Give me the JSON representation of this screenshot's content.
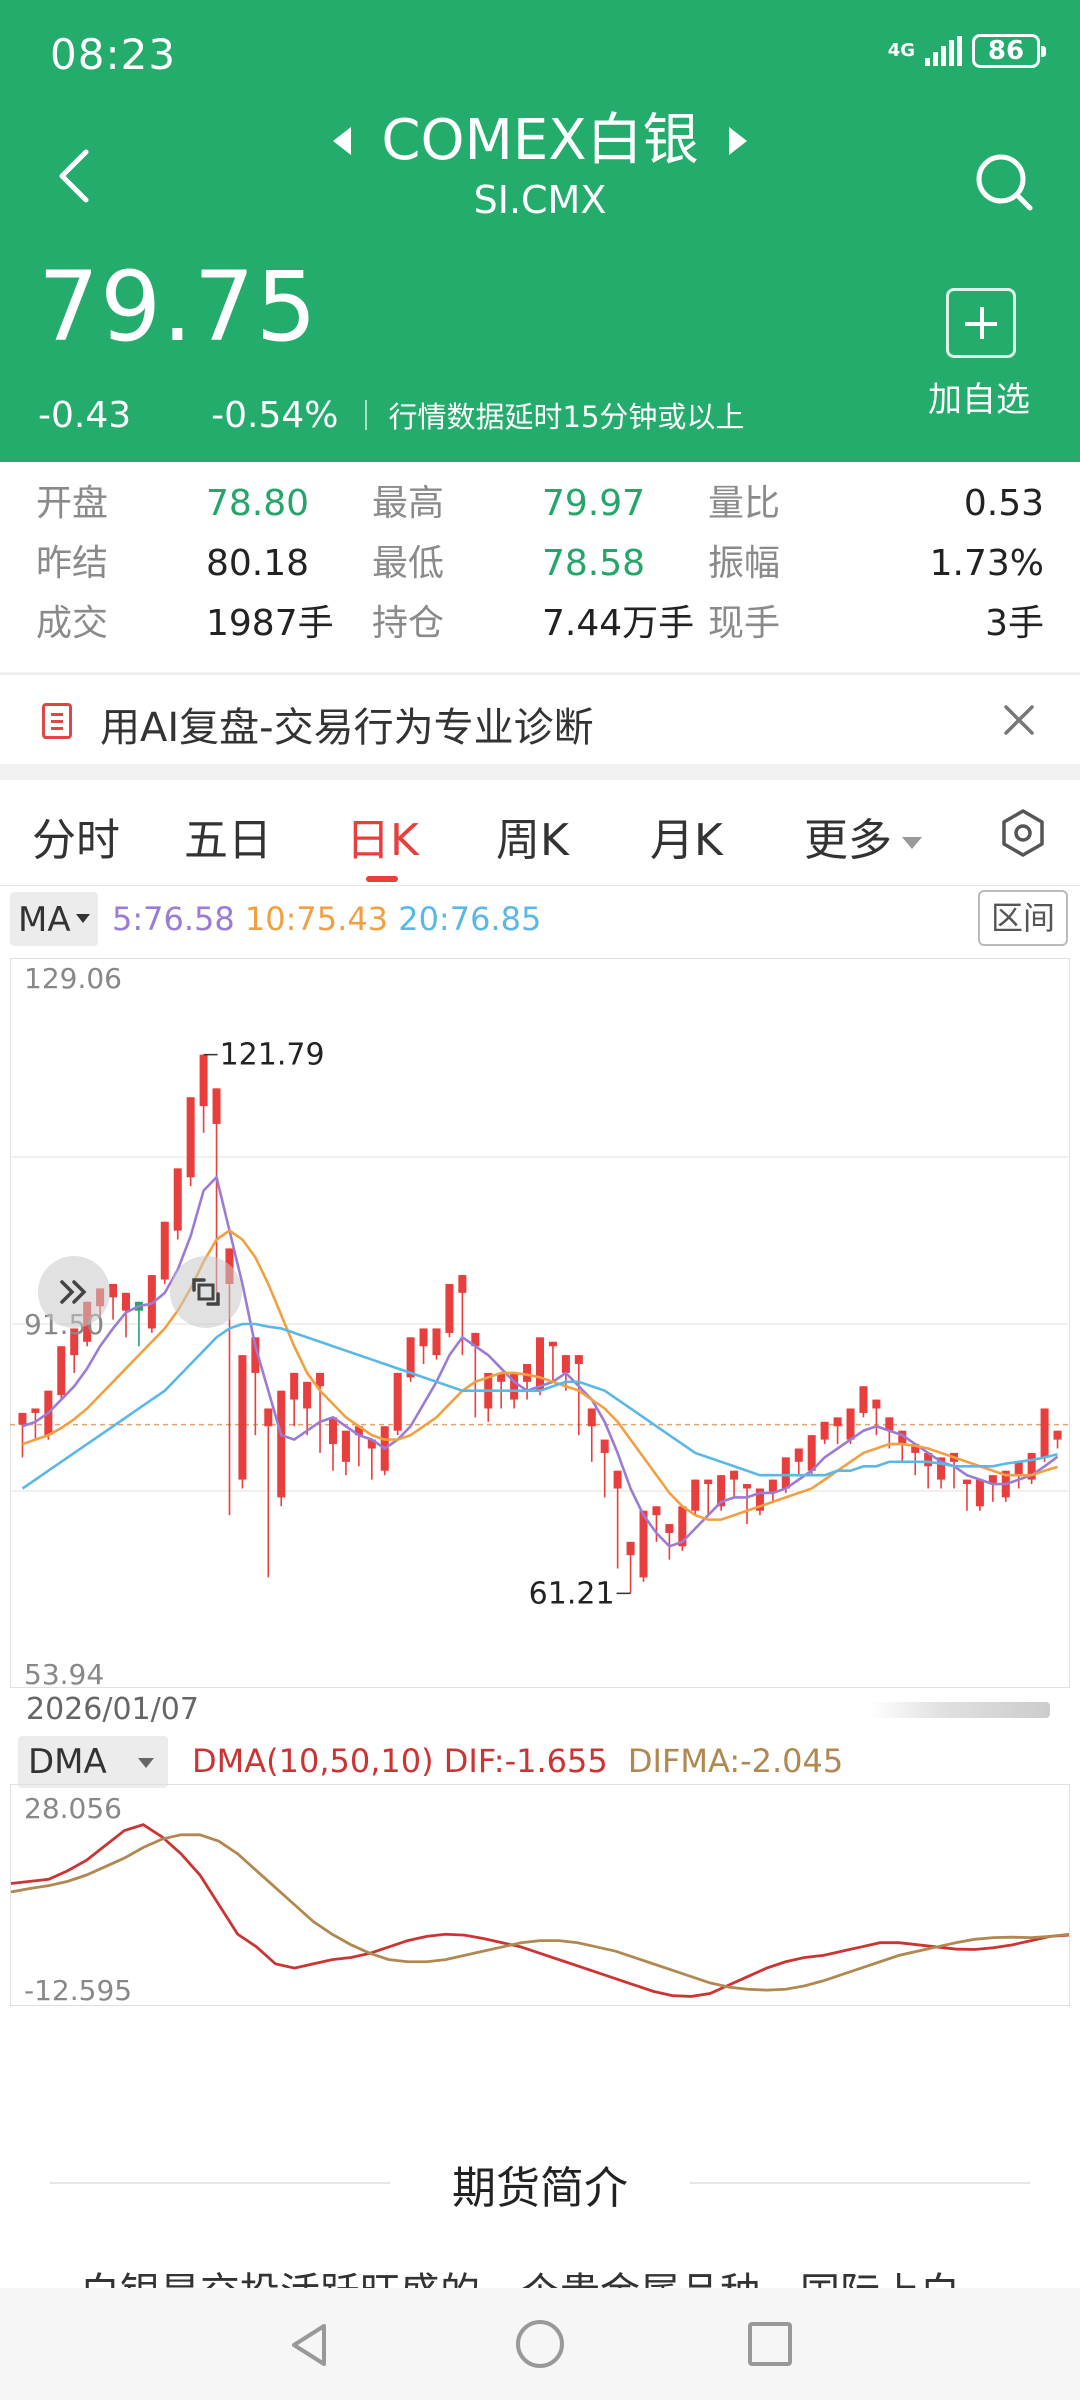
{
  "status_bar": {
    "time": "08:23",
    "network": "4G",
    "battery": "86"
  },
  "header": {
    "title": "COMEX白银",
    "subtitle": "SI.CMX",
    "price": "79.75",
    "change": "-0.43",
    "change_pct": "-0.54%",
    "delay_note": "行情数据延时15分钟或以上",
    "add_label": "加自选"
  },
  "quote": {
    "open_label": "开盘",
    "open": "78.80",
    "high_label": "最高",
    "high": "79.97",
    "vol_ratio_label": "量比",
    "vol_ratio": "0.53",
    "prev_settle_label": "昨结",
    "prev_settle": "80.18",
    "low_label": "最低",
    "low": "78.58",
    "amplitude_label": "振幅",
    "amplitude": "1.73%",
    "volume_label": "成交",
    "volume": "1987手",
    "open_interest_label": "持仓",
    "open_interest": "7.44万手",
    "current_hand_label": "现手",
    "current_hand": "3手"
  },
  "banner": {
    "text": "用AI复盘-交易行为专业诊断"
  },
  "tabs": [
    {
      "label": "分时"
    },
    {
      "label": "五日"
    },
    {
      "label": "日K"
    },
    {
      "label": "周K"
    },
    {
      "label": "月K"
    },
    {
      "label": "更多"
    }
  ],
  "ma_bar": {
    "button": "MA",
    "ma5": "5:76.58",
    "ma10": "10:75.43",
    "ma20": "20:76.85",
    "range_button": "区间"
  },
  "colors": {
    "brand_green": "#24ac6c",
    "up_red": "#e83e3e",
    "down_green": "#24a56a",
    "ma5": "#9b7bd6",
    "ma10": "#f0a040",
    "ma20": "#5ab8e6",
    "dif": "#cc3333",
    "difma": "#b08850"
  },
  "chart_data": [
    {
      "type": "candlestick",
      "y_top_label": "129.06",
      "y_mid_label": "91.50",
      "y_bottom_label": "53.94",
      "ylim": [
        53.94,
        129.06
      ],
      "max_annotation": "121.79",
      "min_annotation": "61.21",
      "x_date_label": "2026/01/07",
      "reference_price": 80.18,
      "candles": [
        [
          80.2,
          81.5,
          78.0,
          76.5
        ],
        [
          81.5,
          82.0,
          78.5,
          79.0
        ],
        [
          79.0,
          84.0,
          78.5,
          83.5
        ],
        [
          83.5,
          89.0,
          83.0,
          88.0
        ],
        [
          88.0,
          91.0,
          86.0,
          89.5
        ],
        [
          89.5,
          94.0,
          89.0,
          93.5
        ],
        [
          93.5,
          95.5,
          91.0,
          94.5
        ],
        [
          94.5,
          96.0,
          92.0,
          93.0
        ],
        [
          93.0,
          95.0,
          90.0,
          94.0
        ],
        [
          94.0,
          93.0,
          89.0,
          91.0
        ],
        [
          91.0,
          97.0,
          90.5,
          96.5
        ],
        [
          96.5,
          103.0,
          96.0,
          102.0
        ],
        [
          102.0,
          109.0,
          101.0,
          108.0
        ],
        [
          108.0,
          117.0,
          107.0,
          116.0
        ],
        [
          116.0,
          121.79,
          113.0,
          114.0
        ],
        [
          114.0,
          118.0,
          95.0,
          96.0
        ],
        [
          96.0,
          100.0,
          70.0,
          74.0
        ],
        [
          74.0,
          88.0,
          73.0,
          86.0
        ],
        [
          86.0,
          90.0,
          79.0,
          80.0
        ],
        [
          80.0,
          82.0,
          63.0,
          72.0
        ],
        [
          72.0,
          84.0,
          71.0,
          83.0
        ],
        [
          83.0,
          86.0,
          80.0,
          82.0
        ],
        [
          82.0,
          85.0,
          79.0,
          84.5
        ],
        [
          84.5,
          86.0,
          77.0,
          78.0
        ],
        [
          78.0,
          81.0,
          75.0,
          76.0
        ],
        [
          76.0,
          79.5,
          74.5,
          79.0
        ],
        [
          79.0,
          80.0,
          75.5,
          77.5
        ],
        [
          77.5,
          78.5,
          74.0,
          75.0
        ],
        [
          75.0,
          80.0,
          74.5,
          79.5
        ],
        [
          79.5,
          86.0,
          79.0,
          85.5
        ],
        [
          85.5,
          90.0,
          85.0,
          89.0
        ],
        [
          89.0,
          91.0,
          87.0,
          88.0
        ],
        [
          88.0,
          91.0,
          87.5,
          90.5
        ],
        [
          90.5,
          96.0,
          90.0,
          95.0
        ],
        [
          95.0,
          97.0,
          88.0,
          89.0
        ],
        [
          89.0,
          90.5,
          81.0,
          82.0
        ],
        [
          82.0,
          86.0,
          80.5,
          85.0
        ],
        [
          85.0,
          86.0,
          82.0,
          83.0
        ],
        [
          83.0,
          86.0,
          82.0,
          85.0
        ],
        [
          85.0,
          87.0,
          83.0,
          84.0
        ],
        [
          84.0,
          90.0,
          83.5,
          89.0
        ],
        [
          89.0,
          89.5,
          85.0,
          86.0
        ],
        [
          86.0,
          88.0,
          84.0,
          87.0
        ],
        [
          87.0,
          88.0,
          79.0,
          80.0
        ],
        [
          80.0,
          82.0,
          76.0,
          77.0
        ],
        [
          77.0,
          78.5,
          72.0,
          73.0
        ],
        [
          73.0,
          75.0,
          64.0,
          65.5
        ],
        [
          65.5,
          67.0,
          61.21,
          63.0
        ],
        [
          63.0,
          70.5,
          62.5,
          70.0
        ],
        [
          70.0,
          71.0,
          67.0,
          68.0
        ],
        [
          68.0,
          69.0,
          65.0,
          66.5
        ],
        [
          66.5,
          71.0,
          66.0,
          70.5
        ],
        [
          70.5,
          74.0,
          70.0,
          73.5
        ],
        [
          73.5,
          74.0,
          70.0,
          71.0
        ],
        [
          71.0,
          74.5,
          70.5,
          74.0
        ],
        [
          74.0,
          75.0,
          72.0,
          73.0
        ],
        [
          73.0,
          73.5,
          69.0,
          70.5
        ],
        [
          70.5,
          73.0,
          70.0,
          72.5
        ],
        [
          72.5,
          74.0,
          71.5,
          73.0
        ],
        [
          73.0,
          76.5,
          72.5,
          76.0
        ],
        [
          76.0,
          77.5,
          74.5,
          75.0
        ],
        [
          75.0,
          79.0,
          74.5,
          78.5
        ],
        [
          78.5,
          80.5,
          78.0,
          80.0
        ],
        [
          80.0,
          81.0,
          78.0,
          78.5
        ],
        [
          78.5,
          82.0,
          78.0,
          81.5
        ],
        [
          81.5,
          84.5,
          81.0,
          82.0
        ],
        [
          82.0,
          83.0,
          79.0,
          79.5
        ],
        [
          79.5,
          81.0,
          77.5,
          78.0
        ],
        [
          78.0,
          79.5,
          76.0,
          77.0
        ],
        [
          77.0,
          78.0,
          74.5,
          75.5
        ],
        [
          75.5,
          77.0,
          73.0,
          74.0
        ],
        [
          74.0,
          76.5,
          73.0,
          76.0
        ],
        [
          76.0,
          77.0,
          73.0,
          73.5
        ],
        [
          73.5,
          74.0,
          70.5,
          71.0
        ],
        [
          71.0,
          74.0,
          70.5,
          73.5
        ],
        [
          73.5,
          74.5,
          71.5,
          72.0
        ],
        [
          72.0,
          75.0,
          71.5,
          74.5
        ],
        [
          74.5,
          76.0,
          73.0,
          74.0
        ],
        [
          74.0,
          77.0,
          73.5,
          76.5
        ],
        [
          76.5,
          82.0,
          76.0,
          78.5
        ],
        [
          78.5,
          79.5,
          77.5,
          79.0
        ]
      ],
      "series": [
        {
          "name": "MA5",
          "values": [
            80.0,
            80.5,
            81.5,
            83.0,
            84.5,
            86.5,
            89.0,
            91.0,
            92.8,
            93.5,
            93.8,
            95.0,
            97.6,
            101.4,
            106.5,
            108.0,
            102.0,
            96.0,
            89.0,
            84.0,
            79.0,
            78.5,
            79.5,
            80.5,
            81.0,
            80.0,
            79.0,
            78.5,
            77.5,
            78.5,
            80.0,
            82.5,
            85.0,
            88.0,
            90.0,
            89.0,
            88.0,
            86.5,
            85.0,
            84.0,
            84.5,
            85.0,
            86.0,
            84.5,
            83.0,
            80.5,
            77.0,
            73.0,
            70.0,
            68.0,
            66.5,
            67.0,
            68.5,
            70.0,
            71.5,
            72.0,
            72.0,
            72.5,
            72.5,
            73.0,
            74.0,
            75.0,
            76.5,
            77.5,
            78.5,
            79.5,
            80.0,
            79.5,
            79.0,
            78.0,
            77.0,
            76.0,
            75.5,
            74.5,
            74.0,
            73.5,
            73.5,
            74.0,
            74.5,
            75.5,
            76.58
          ]
        },
        {
          "name": "MA10",
          "values": [
            78.0,
            78.5,
            79.0,
            79.8,
            80.8,
            82.0,
            83.5,
            85.0,
            86.5,
            88.0,
            89.5,
            91.0,
            93.0,
            95.5,
            98.5,
            101.0,
            102.0,
            101.0,
            99.0,
            96.0,
            92.5,
            89.0,
            86.0,
            84.0,
            82.5,
            81.0,
            80.0,
            79.0,
            78.5,
            78.5,
            79.0,
            80.0,
            81.0,
            82.5,
            84.0,
            85.0,
            85.5,
            86.0,
            86.0,
            85.8,
            85.5,
            85.0,
            84.5,
            84.0,
            83.0,
            82.0,
            80.5,
            78.5,
            76.5,
            74.5,
            72.5,
            71.0,
            70.0,
            69.5,
            69.5,
            70.0,
            70.5,
            71.0,
            71.5,
            72.0,
            72.5,
            73.0,
            74.0,
            75.0,
            76.0,
            77.0,
            77.5,
            78.0,
            78.0,
            77.8,
            77.5,
            77.0,
            76.5,
            76.0,
            75.5,
            75.0,
            74.5,
            74.5,
            74.5,
            75.0,
            75.43
          ]
        },
        {
          "name": "MA20",
          "values": [
            73.0,
            74.0,
            75.0,
            76.0,
            77.0,
            78.0,
            79.0,
            80.0,
            81.0,
            82.0,
            83.0,
            84.0,
            85.5,
            87.0,
            88.5,
            90.0,
            91.0,
            91.5,
            91.5,
            91.2,
            91.0,
            90.5,
            90.0,
            89.5,
            89.0,
            88.5,
            88.0,
            87.5,
            87.0,
            86.5,
            86.0,
            85.5,
            85.0,
            84.5,
            84.0,
            84.0,
            84.0,
            84.0,
            84.0,
            84.0,
            84.0,
            84.5,
            85.0,
            85.0,
            84.5,
            84.0,
            83.0,
            82.0,
            81.0,
            80.0,
            79.0,
            78.0,
            77.0,
            76.5,
            76.0,
            75.5,
            75.0,
            74.5,
            74.5,
            74.5,
            74.5,
            74.5,
            74.5,
            75.0,
            75.0,
            75.5,
            75.5,
            76.0,
            76.0,
            76.0,
            76.0,
            75.8,
            75.5,
            75.5,
            75.5,
            75.5,
            75.8,
            76.0,
            76.2,
            76.5,
            76.85
          ]
        }
      ]
    },
    {
      "type": "line",
      "label": "DMA(10,50,10)",
      "dif_label": "DIF:-1.655",
      "difma_label": "DIFMA:-2.045",
      "y_top_label": "28.056",
      "y_bottom_label": "-12.595",
      "ylim": [
        -12.595,
        28.056
      ],
      "series": [
        {
          "name": "DIF",
          "values": [
            14,
            14.5,
            15,
            17,
            19.5,
            23,
            26.5,
            27.9,
            25,
            21,
            16,
            9,
            2,
            -1,
            -5,
            -6,
            -5,
            -4,
            -3.5,
            -2.5,
            -1,
            0.5,
            1.5,
            2,
            1.8,
            1,
            0,
            -1,
            -2.5,
            -4,
            -5.5,
            -7,
            -8.5,
            -10,
            -11.5,
            -12.5,
            -12.7,
            -12,
            -10,
            -8,
            -6,
            -4.5,
            -3.5,
            -3,
            -2,
            -1,
            0,
            0,
            -0.5,
            -1,
            -1.5,
            -1.6,
            -1.2,
            -0.5,
            0.5,
            1.5,
            1.8
          ]
        },
        {
          "name": "DIFMA",
          "values": [
            12,
            12.8,
            13.5,
            14.5,
            16,
            18,
            20,
            22.5,
            24.5,
            25.5,
            25.5,
            24,
            21,
            17,
            13,
            9,
            5,
            2,
            -0.5,
            -2.5,
            -4,
            -4.5,
            -4.5,
            -4,
            -3,
            -2,
            -1,
            0,
            0.5,
            0.5,
            0,
            -1,
            -2,
            -3.5,
            -5,
            -6.5,
            -8,
            -9.5,
            -10.5,
            -11,
            -11.2,
            -11,
            -10.2,
            -9,
            -7.5,
            -6,
            -4.5,
            -3,
            -2,
            -1,
            0,
            0.8,
            1.2,
            1.3,
            1.2,
            1.5,
            2
          ]
        }
      ]
    }
  ],
  "intro": {
    "title": "期货简介",
    "text": "白银是交投活跃旺盛的一个贵金属品种，国际上白"
  }
}
